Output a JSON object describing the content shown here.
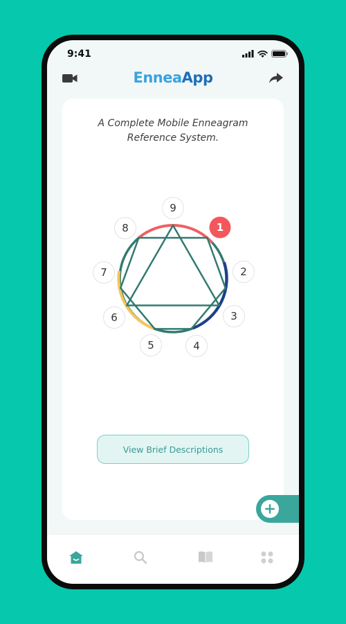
{
  "status_bar": {
    "time": "9:41"
  },
  "header": {
    "title_part1": "Ennea",
    "title_part2": "App",
    "left_icon": "video-camera-icon",
    "right_icon": "share-arrow-icon"
  },
  "card": {
    "tagline_line1": "A Complete Mobile Enneagram",
    "tagline_line2": "Reference System.",
    "enneagram": {
      "points": [
        "9",
        "1",
        "2",
        "3",
        "4",
        "5",
        "6",
        "7",
        "8"
      ],
      "selected": "1"
    },
    "button_label": "View Brief Descriptions"
  },
  "fab": {
    "icon": "plus-icon"
  },
  "tab_bar": {
    "items": [
      {
        "icon": "home-icon",
        "active": true
      },
      {
        "icon": "search-icon",
        "active": false
      },
      {
        "icon": "book-icon",
        "active": false
      },
      {
        "icon": "grid-icon",
        "active": false
      }
    ]
  },
  "colors": {
    "background": "#06c8ac",
    "accent": "#3aa69c",
    "selected_point": "#f2575c",
    "brand_light": "#39a3df",
    "brand_dark": "#1d6fb8"
  }
}
